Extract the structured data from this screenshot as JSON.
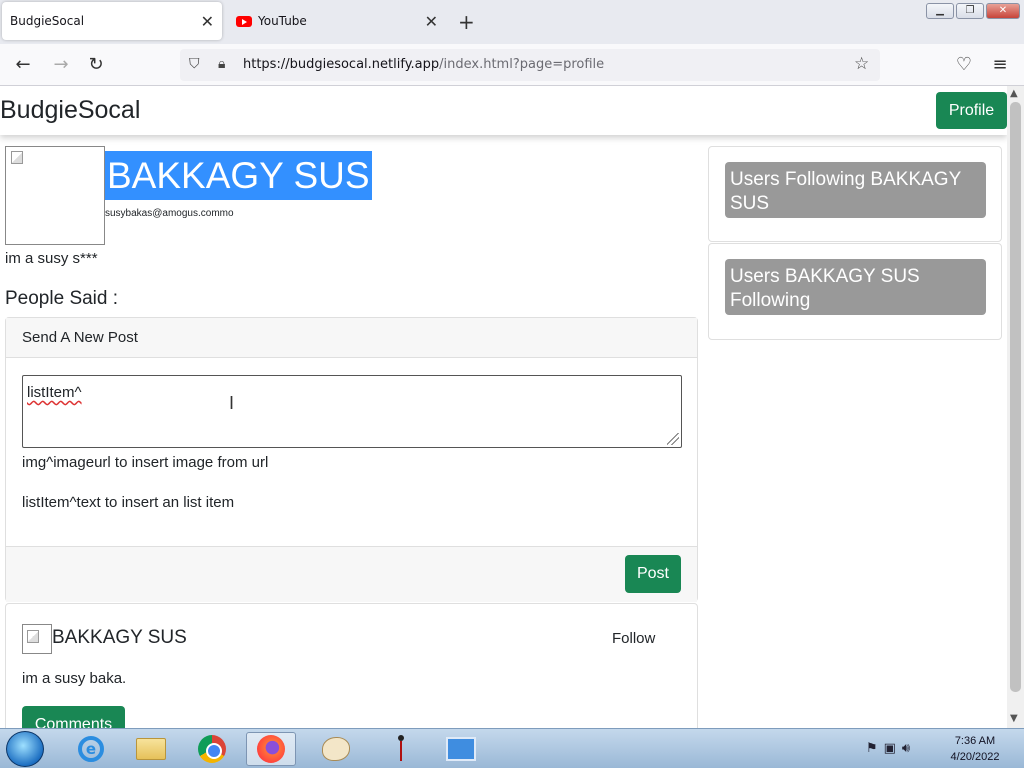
{
  "browser": {
    "tabs": [
      {
        "title": "BudgieSocal",
        "active": true
      },
      {
        "title": "YouTube",
        "active": false
      }
    ],
    "url_host": "https://budgiesocal.netlify.app",
    "url_path": "/index.html?page=profile"
  },
  "site": {
    "brand": "BudgieSocal",
    "profile_button": "Profile"
  },
  "profile": {
    "name": "BAKKAGY SUS",
    "email": "susybakas@amogus.commo",
    "bio": "im a susy s***",
    "people_said": "People Said :"
  },
  "new_post": {
    "header": "Send A New Post",
    "textarea_value": "listItem^",
    "hint_image": "img^imageurl to insert image from url",
    "hint_list": "listItem^text to insert an list item",
    "post_button": "Post"
  },
  "feed": [
    {
      "author": "BAKKAGY SUS",
      "follow_label": "Follow",
      "text": "im a susy baka.",
      "comments_label": "Comments"
    }
  ],
  "sidebar": {
    "followers_title": "Users Following BAKKAGY SUS",
    "following_title": "Users BAKKAGY SUS Following"
  },
  "taskbar": {
    "time": "7:36 AM",
    "date": "4/20/2022"
  },
  "colors": {
    "primary_green": "#198754",
    "selection_blue": "#3390ff",
    "sidebar_gray": "#999999"
  }
}
